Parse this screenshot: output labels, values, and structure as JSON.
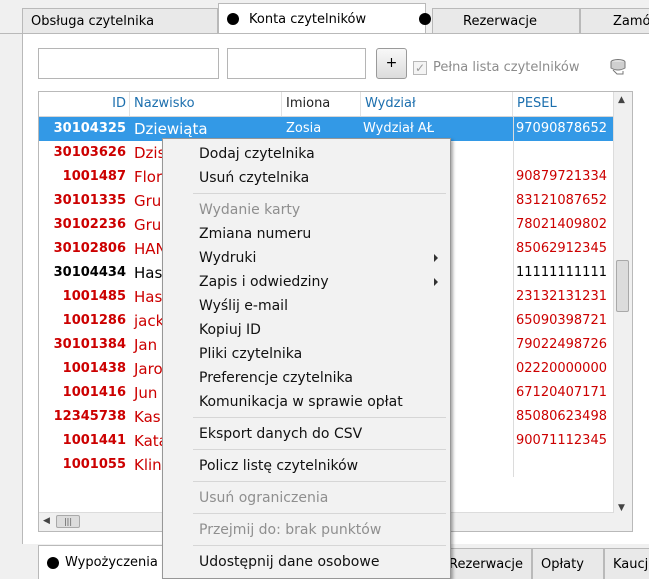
{
  "top_tabs": [
    {
      "label": "Obsługa czytelnika"
    },
    {
      "label": "Konta czytelników"
    },
    {
      "label": "Rezerwacje"
    },
    {
      "label": "Zamó"
    }
  ],
  "search": {
    "field1_value": "",
    "field2_value": "",
    "add_label": "+",
    "full_list_label": "Pełna lista czytelników",
    "full_list_checked": true
  },
  "table": {
    "headers": {
      "id": "ID",
      "nazwisko": "Nazwisko",
      "imiona": "Imiona",
      "wydzial": "Wydział",
      "pesel": "PESEL"
    },
    "rows": [
      {
        "id": "30104325",
        "name": "Dziewiąta",
        "imiona": "Zosia",
        "wydzial": "Wydział AŁ",
        "pesel": "97090878652"
      },
      {
        "id": "30103626",
        "name": "Dzis",
        "imiona": "",
        "wydzial": "",
        "pesel": ""
      },
      {
        "id": "1001487",
        "name": "Flor",
        "imiona": "",
        "wydzial": "",
        "pesel": "90879721334"
      },
      {
        "id": "30101335",
        "name": "Gru",
        "imiona": "",
        "wydzial": "",
        "pesel": "83121087652"
      },
      {
        "id": "30102236",
        "name": "Gru",
        "imiona": "",
        "wydzial": "",
        "pesel": "78021409802"
      },
      {
        "id": "30102806",
        "name": "HAN",
        "imiona": "",
        "wydzial": "",
        "pesel": "85062912345"
      },
      {
        "id": "30104434",
        "name": "Has",
        "imiona": "",
        "wydzial": "",
        "pesel": "11111111111"
      },
      {
        "id": "1001485",
        "name": "Has",
        "imiona": "",
        "wydzial": "",
        "pesel": "23132131231"
      },
      {
        "id": "1001286",
        "name": "jack",
        "imiona": "",
        "wydzial": "",
        "pesel": "65090398721"
      },
      {
        "id": "30101384",
        "name": "Jan",
        "imiona": "",
        "wydzial": "",
        "pesel": "79022498726"
      },
      {
        "id": "1001438",
        "name": "Jaro",
        "imiona": "",
        "wydzial": "",
        "pesel": "02220000000"
      },
      {
        "id": "1001416",
        "name": "Jun",
        "imiona": "",
        "wydzial": "",
        "pesel": "67120407171"
      },
      {
        "id": "12345738",
        "name": "Kas",
        "imiona": "",
        "wydzial": "",
        "pesel": "85080623498"
      },
      {
        "id": "1001441",
        "name": "Kata",
        "imiona": "",
        "wydzial": "",
        "pesel": "90071112345"
      },
      {
        "id": "1001055",
        "name": "Klin",
        "imiona": "",
        "wydzial": "",
        "pesel": ""
      }
    ]
  },
  "context_menu": {
    "items": [
      {
        "label": "Dodaj czytelnika",
        "disabled": false,
        "submenu": false
      },
      {
        "label": "Usuń czytelnika",
        "disabled": false,
        "submenu": false
      },
      {
        "label": "Wydanie karty",
        "disabled": true,
        "submenu": false
      },
      {
        "label": "Zmiana numeru",
        "disabled": false,
        "submenu": false
      },
      {
        "label": "Wydruki",
        "disabled": false,
        "submenu": true
      },
      {
        "label": "Zapis i odwiedziny",
        "disabled": false,
        "submenu": true
      },
      {
        "label": "Wyślij e-mail",
        "disabled": false,
        "submenu": false
      },
      {
        "label": "Kopiuj ID",
        "disabled": false,
        "submenu": false
      },
      {
        "label": "Pliki czytelnika",
        "disabled": false,
        "submenu": false
      },
      {
        "label": "Preferencje czytelnika",
        "disabled": false,
        "submenu": false
      },
      {
        "label": "Komunikacja w sprawie opłat",
        "disabled": false,
        "submenu": false
      },
      {
        "label": "Eksport danych do CSV",
        "disabled": false,
        "submenu": false
      },
      {
        "label": "Policz listę czytelników",
        "disabled": false,
        "submenu": false
      },
      {
        "label": "Usuń ograniczenia",
        "disabled": true,
        "submenu": false
      },
      {
        "label": "Przejmij do: brak punktów",
        "disabled": true,
        "submenu": false
      },
      {
        "label": "Udostępnij dane osobowe",
        "disabled": false,
        "submenu": false
      }
    ]
  },
  "bottom_tabs": [
    {
      "label": "Wypożyczenia"
    },
    {
      "label": "Rezerwacje"
    },
    {
      "label": "Opłaty"
    },
    {
      "label": "Kaucj"
    }
  ],
  "colors": {
    "accent": "#1c6fae",
    "id_red": "#cc0000",
    "selection": "#3399e6"
  }
}
